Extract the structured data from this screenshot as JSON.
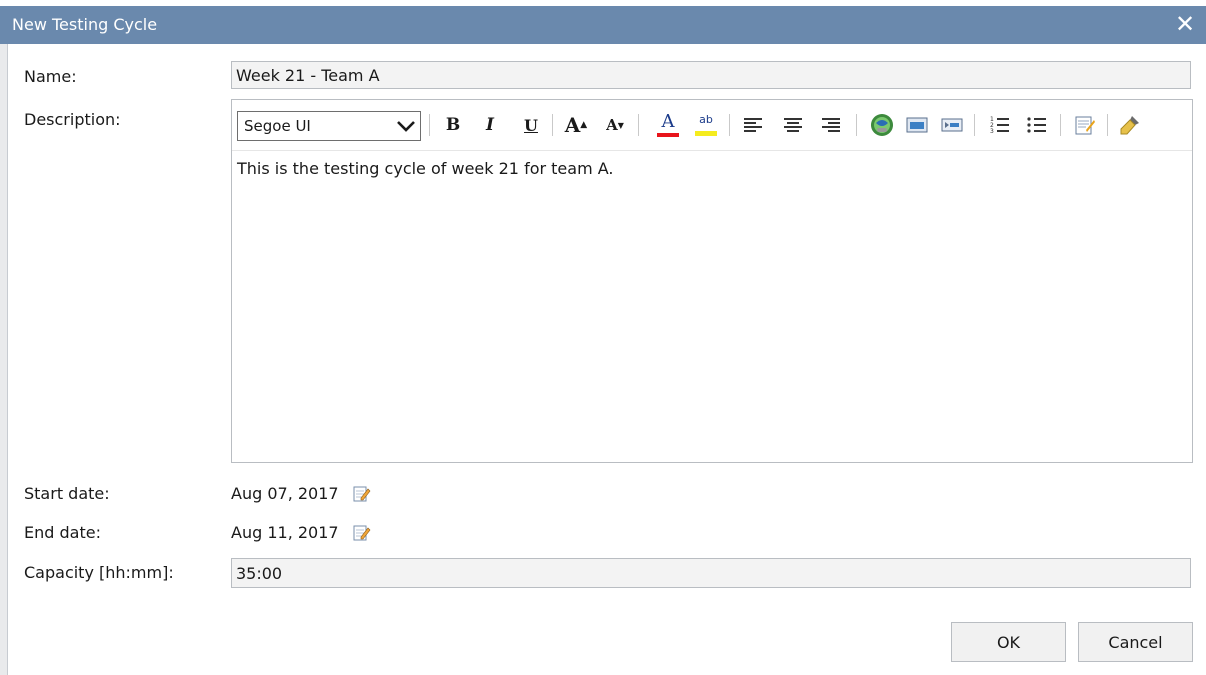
{
  "dialog": {
    "title": "New Testing Cycle",
    "close_glyph": "✕"
  },
  "form": {
    "name_label": "Name:",
    "name_value": "Week 21 - Team A",
    "description_label": "Description:",
    "description_text": "This is the testing cycle of week 21 for team A.",
    "start_label": "Start date:",
    "start_value": "Aug 07, 2017",
    "end_label": "End date:",
    "end_value": "Aug 11, 2017",
    "capacity_label": "Capacity [hh:mm]:",
    "capacity_value": "35:00"
  },
  "editor_toolbar": {
    "font": "Segoe UI",
    "bold": "B",
    "italic": "I",
    "underline": "U",
    "grow_font": "A",
    "shrink_font": "A",
    "font_color_glyph": "A",
    "highlight_glyph": "ab",
    "colors": {
      "font_color": "#e8141b",
      "highlight": "#f5ec1e"
    },
    "icons": [
      "font-dropdown-chevron-icon",
      "bold-icon",
      "italic-icon",
      "underline-icon",
      "grow-font-icon",
      "shrink-font-icon",
      "font-color-icon",
      "highlight-icon",
      "align-left-icon",
      "align-center-icon",
      "align-right-icon",
      "insert-link-icon",
      "insert-image-icon",
      "insert-media-icon",
      "numbered-list-icon",
      "bulleted-list-icon",
      "format-icon",
      "clear-formatting-icon"
    ]
  },
  "buttons": {
    "ok": "OK",
    "cancel": "Cancel"
  },
  "colors": {
    "titlebar": "#6a89ad",
    "field_bg": "#f3f3f3",
    "border": "#b9bdc2"
  }
}
